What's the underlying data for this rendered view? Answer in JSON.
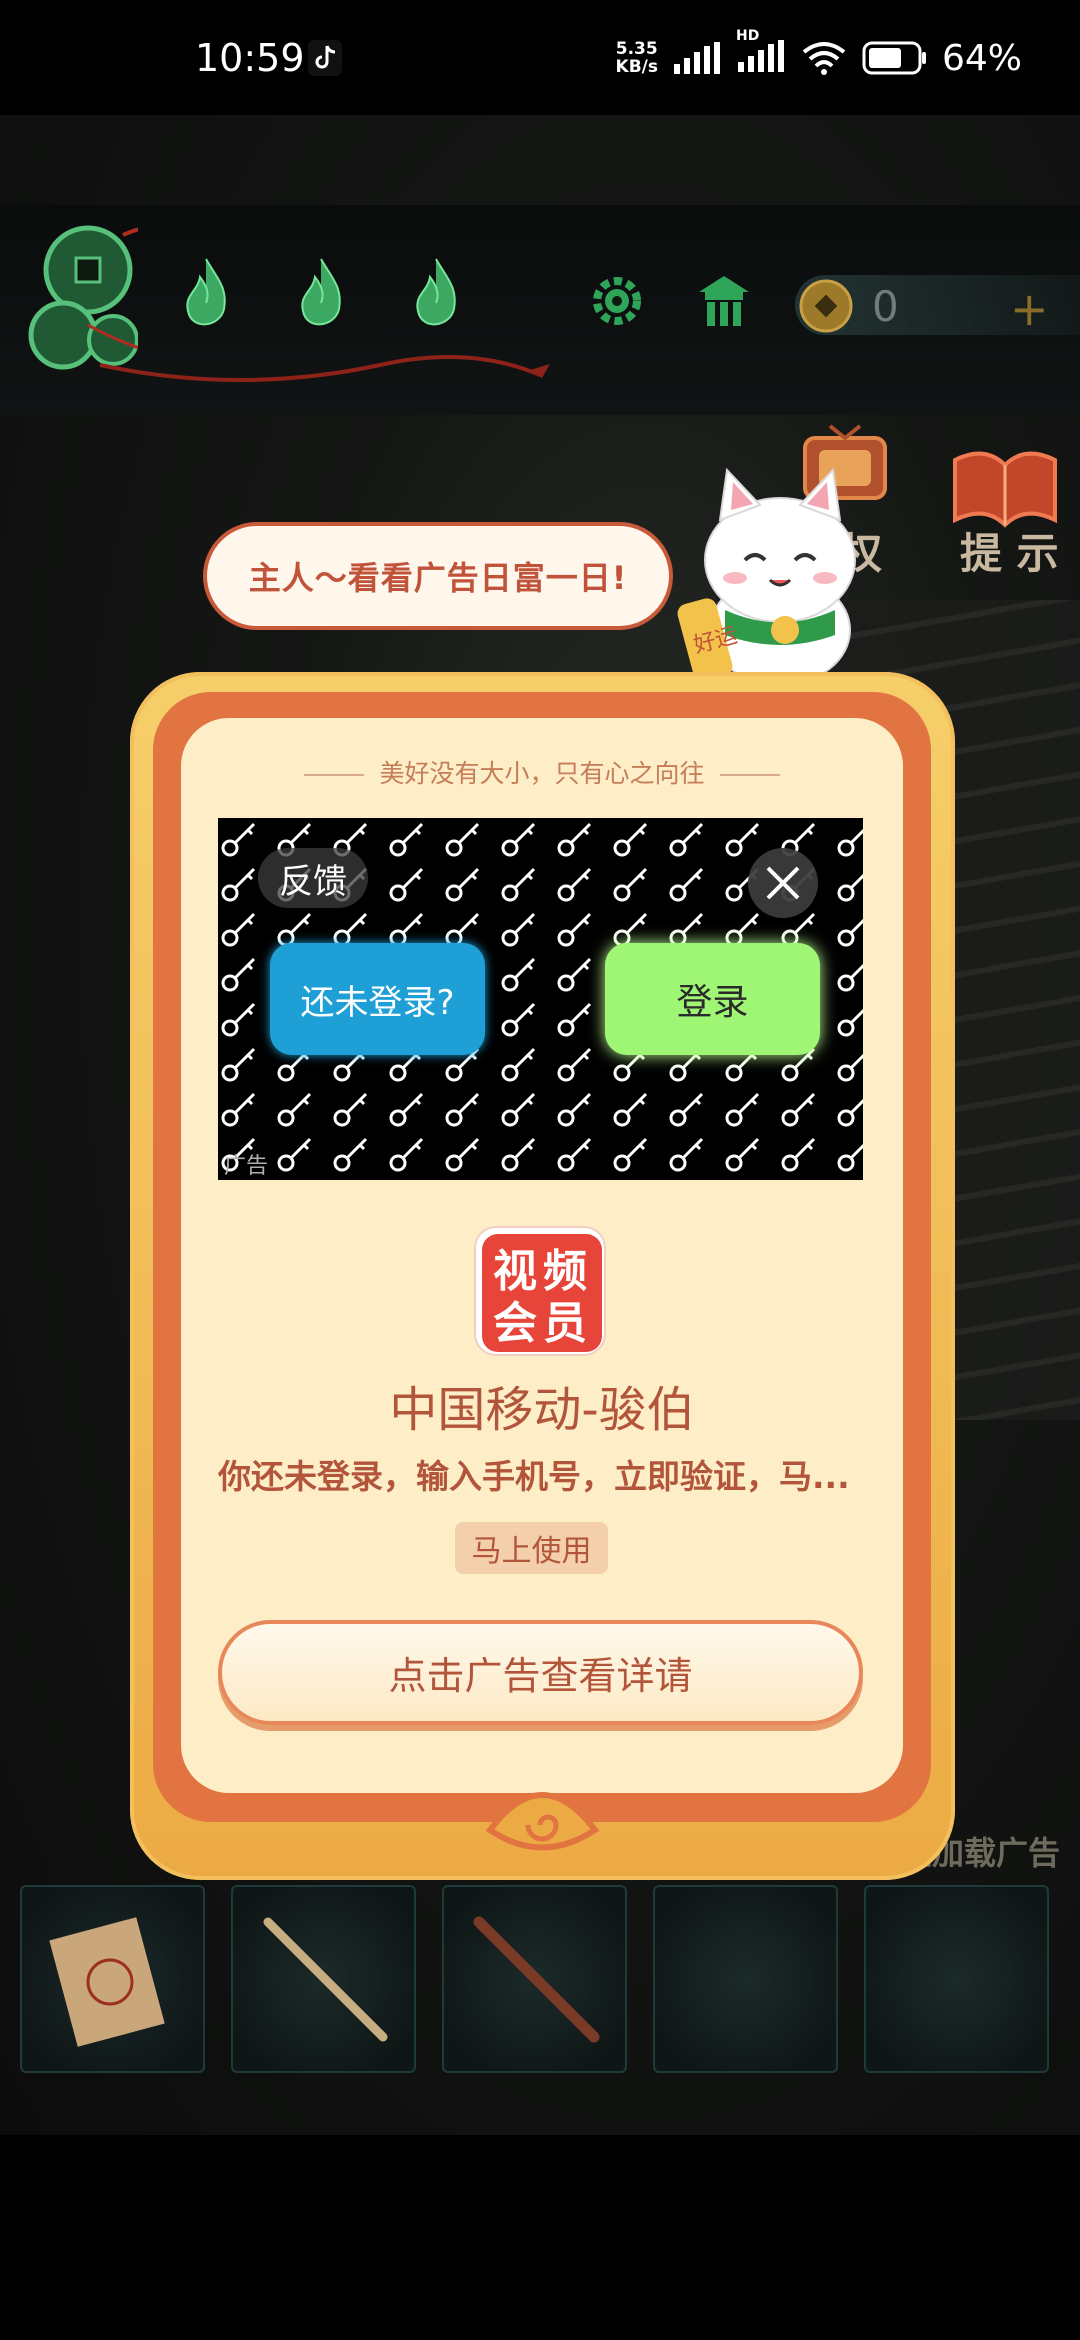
{
  "status_bar": {
    "time": "10:59",
    "net_speed_value": "5.35",
    "net_speed_unit": "KB/s",
    "hd_label": "HD",
    "battery": "64%"
  },
  "hud": {
    "coin_count": "0",
    "plus": "+"
  },
  "side_buttons": {
    "rights_label_partial": "权",
    "hint_label": "提 示"
  },
  "bubble": {
    "text": "主人～看看广告日富一日!"
  },
  "cat": {
    "badge": "好运"
  },
  "modal": {
    "tagline": "美好没有大小，只有心之向往",
    "ad": {
      "feedback_label": "反馈",
      "unlogged_label": "还未登录?",
      "login_label": "登录",
      "ad_mark": "广告"
    },
    "app_icon_text": [
      "视",
      "频",
      "会",
      "员"
    ],
    "app_name": "中国移动-骏伯",
    "app_desc": "你还未登录，输入手机号，立即验证，马...",
    "use_now_label": "马上使用",
    "detail_button_label": "点击广告查看详请"
  },
  "loading_text": "正在加载广告",
  "colors": {
    "accent_orange": "#e27441",
    "modal_cream": "#fdeec8",
    "text_brown": "#b2553a",
    "login_green": "#9ff574",
    "unlogged_blue": "#1e9fd6"
  }
}
